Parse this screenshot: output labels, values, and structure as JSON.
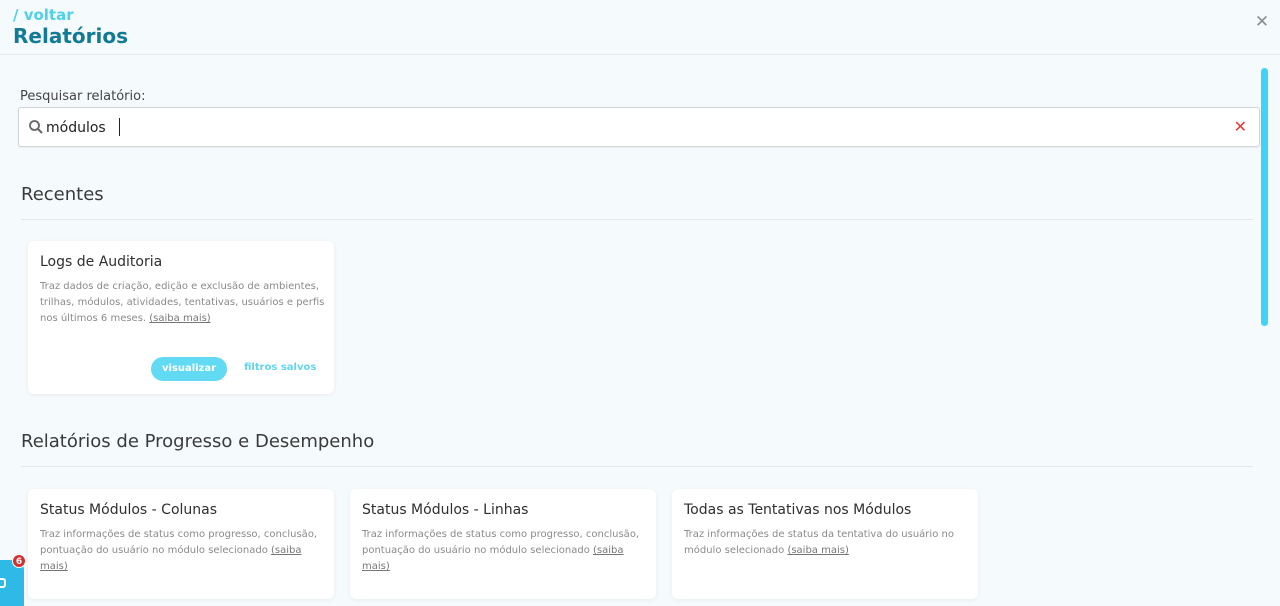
{
  "header": {
    "back_label": "/ voltar",
    "title": "Relatórios",
    "close_symbol": "✕"
  },
  "search": {
    "label": "Pesquisar relatório:",
    "value": "módulos",
    "clear_symbol": "✕"
  },
  "sections": {
    "recentes": {
      "title": "Recentes",
      "cards": [
        {
          "title": "Logs de Auditoria",
          "description": "Traz dados de criação, edição e exclusão de ambientes, trilhas, módulos, atividades, tentativas, usuários e perfis nos últimos 6 meses.",
          "more": "(saiba mais)",
          "view_label": "visualizar",
          "saved_label": "filtros salvos"
        }
      ]
    },
    "progresso": {
      "title": "Relatórios de Progresso e Desempenho",
      "cards": [
        {
          "title": "Status Módulos - Colunas",
          "description": "Traz informações de status como progresso, conclusão, pontuação do usuário no módulo selecionado",
          "more": "(saiba mais)"
        },
        {
          "title": "Status Módulos - Linhas",
          "description": "Traz informações de status como progresso, conclusão, pontuação do usuário no módulo selecionado",
          "more": "(saiba mais)"
        },
        {
          "title": "Todas as Tentativas nos Módulos",
          "description": "Traz informações de status da tentativa do usuário no módulo selecionado",
          "more": "(saiba mais)"
        }
      ]
    }
  },
  "chat": {
    "badge_count": "6"
  },
  "colors": {
    "accent": "#4fd1ea",
    "title": "#137a96",
    "clear": "#e53935",
    "badge": "#d32f2f"
  }
}
